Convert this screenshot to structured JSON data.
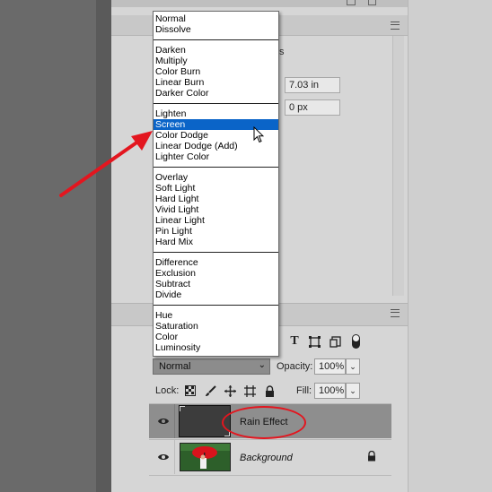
{
  "properties": {
    "field_width_value": "7.03 in",
    "field_offset_value": "0 px",
    "partial_label": "s"
  },
  "blend_menu": {
    "groups": [
      [
        "Normal",
        "Dissolve"
      ],
      [
        "Darken",
        "Multiply",
        "Color Burn",
        "Linear Burn",
        "Darker Color"
      ],
      [
        "Lighten",
        "Screen",
        "Color Dodge",
        "Linear Dodge (Add)",
        "Lighter Color"
      ],
      [
        "Overlay",
        "Soft Light",
        "Hard Light",
        "Vivid Light",
        "Linear Light",
        "Pin Light",
        "Hard Mix"
      ],
      [
        "Difference",
        "Exclusion",
        "Subtract",
        "Divide"
      ],
      [
        "Hue",
        "Saturation",
        "Color",
        "Luminosity"
      ]
    ],
    "selected": "Screen"
  },
  "layers_panel": {
    "blend_mode": "Normal",
    "opacity_label": "Opacity:",
    "opacity_value": "100%",
    "lock_label": "Lock:",
    "fill_label": "Fill:",
    "fill_value": "100%",
    "layers": [
      {
        "name": "Rain Effect",
        "italic": false,
        "selected": true,
        "locked": false
      },
      {
        "name": "Background",
        "italic": true,
        "selected": false,
        "locked": true
      }
    ]
  },
  "icons": {
    "filter_tools": [
      "type-filter-icon",
      "shape-filter-icon",
      "smart-object-filter-icon",
      "filter-toggle-icon"
    ],
    "lock_tools": [
      "lock-transparent-pixels-icon",
      "lock-image-pixels-icon",
      "lock-position-icon",
      "lock-artboard-icon",
      "lock-all-icon"
    ]
  },
  "colors": {
    "selection": "#0a64c8",
    "annotation": "#e3161f",
    "panel": "#d6d6d6"
  }
}
